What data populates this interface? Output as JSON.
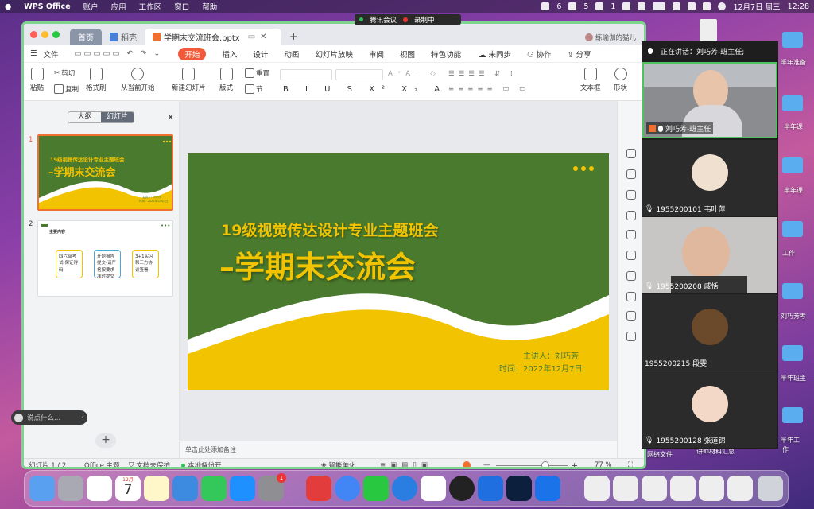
{
  "menubar": {
    "app": "WPS Office",
    "items": [
      "账户",
      "应用",
      "工作区",
      "窗口",
      "帮助"
    ],
    "status": {
      "w_count": "6",
      "bell_count": "5",
      "wechat_count": "1",
      "date": "12月7日 周三",
      "time": "12:28"
    }
  },
  "meeting_pill": {
    "app": "腾讯会议",
    "recording": "录制中"
  },
  "tabs": {
    "home": "首页",
    "daoke": "稻壳",
    "doc": "学期末交流班会.pptx",
    "add": "+",
    "user": "练瑜伽的猫儿"
  },
  "menu": {
    "file": "文件",
    "start": "开始",
    "items": [
      "插入",
      "设计",
      "动画",
      "幻灯片放映",
      "审阅",
      "视图",
      "特色功能"
    ],
    "sync": "未同步",
    "collab": "协作",
    "share": "分享"
  },
  "toolbar": {
    "cut": "剪切",
    "copy": "复制",
    "paste": "粘贴",
    "format_painter": "格式刷",
    "play_from_current": "从当前开始",
    "new_slide": "新建幻灯片",
    "layout": "版式",
    "reset": "重置",
    "section": "节",
    "textbox": "文本框",
    "shape": "形状"
  },
  "panel": {
    "outline": "大纲",
    "slides": "幻灯片",
    "add": "+",
    "chat_placeholder": "说点什么..."
  },
  "slide1": {
    "num": "1",
    "subtitle": "19级视觉传达设计专业主题班会",
    "title": "–学期末交流会",
    "speaker": "主讲人：刘巧芳",
    "time": "时间：2022年12月7日"
  },
  "slide2": {
    "num": "2",
    "header": "主要内容",
    "boxes": [
      "四六级考试-保证得码",
      "开题报告提交-请严格按要求准时提交",
      "3+1实习和三方协议签署"
    ]
  },
  "notes": "单击此处添加备注",
  "status": {
    "page": "幻灯片 1 / 2",
    "theme": "Office 主题",
    "protect": "文档未保护",
    "backup": "本地备份开",
    "beautify": "智能美化",
    "zoom": "77 %",
    "zoom_level": 0.77
  },
  "meeting": {
    "speaking": "正在讲话：刘巧芳-班主任;",
    "participants": [
      "刘巧芳-班主任",
      "1955200101 韦叶萍",
      "1955200208 戚恬",
      "1955200215 段雯",
      "1955200128 张道锦"
    ]
  },
  "desktop": {
    "labels": [
      "半年准备",
      "半年课",
      "半年课",
      "工作",
      "刘巧芳考",
      "半年班主",
      "半年工",
      "作",
      "网络文件",
      "讲师材料汇总"
    ]
  },
  "dock": {
    "calendar_month": "12月",
    "calendar_day": "7",
    "settings_badge": "1"
  },
  "colors": {
    "slide_green": "#4a7a2d",
    "slide_yellow": "#f2c300",
    "start_tab": "#f05a3a",
    "window_border": "#7ed48c"
  }
}
